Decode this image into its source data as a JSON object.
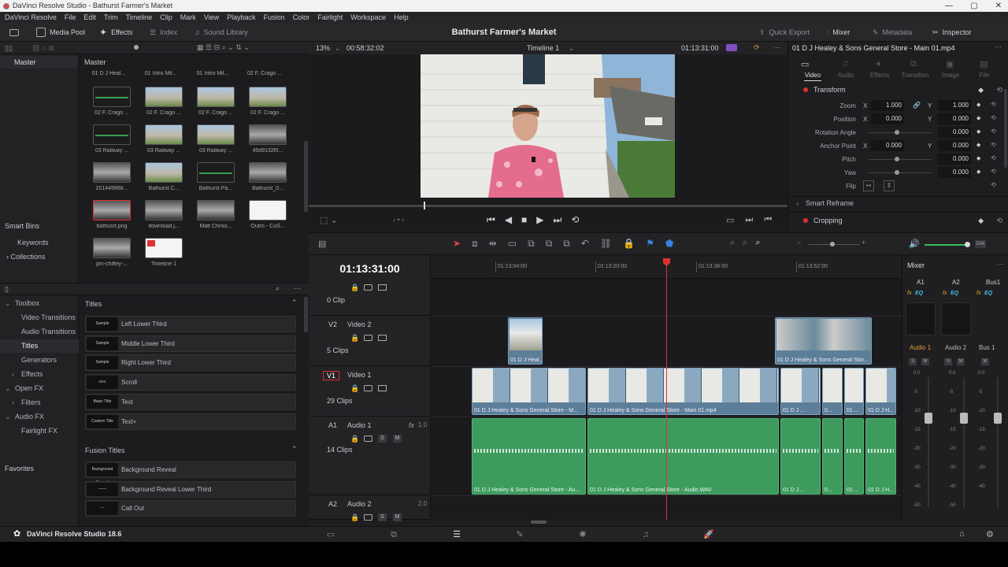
{
  "window": {
    "title": "DaVinci Resolve Studio - Bathurst Farmer's Market",
    "controls": [
      "—",
      "▢",
      "✕"
    ]
  },
  "menu": [
    "DaVinci Resolve",
    "File",
    "Edit",
    "Trim",
    "Timeline",
    "Clip",
    "Mark",
    "View",
    "Playback",
    "Fusion",
    "Color",
    "Fairlight",
    "Workspace",
    "Help"
  ],
  "toolbar": {
    "media_pool": "Media Pool",
    "effects": "Effects",
    "index": "Index",
    "sound_library": "Sound Library",
    "project_title": "Bathurst Farmer's Market",
    "quick_export": "Quick Export",
    "mixer": "Mixer",
    "metadata": "Metadata",
    "inspector": "Inspector"
  },
  "viewer": {
    "zoom": "13%",
    "duration": "00:58:32:02",
    "timeline_name": "Timeline 1",
    "timecode": "01:13:31:00",
    "clip_name": "01 D J Healey & Sons General Store - Main 01.mp4"
  },
  "bins": {
    "master_left": "Master",
    "master_right": "Master",
    "smart_bins": "Smart Bins",
    "keywords": "Keywords",
    "collections": "Collections",
    "favorites": "Favorites"
  },
  "media": {
    "top_labels": [
      "01 D J Heal...",
      "01 Intro Mil...",
      "01 Intro Mil...",
      "02 F. Crago ..."
    ],
    "items": [
      {
        "label": "02 F. Crago ...",
        "kind": "audio"
      },
      {
        "label": "02 F. Crago ...",
        "kind": "video"
      },
      {
        "label": "02 F. Crago ...",
        "kind": "video"
      },
      {
        "label": "02 F. Crago ...",
        "kind": "video"
      },
      {
        "label": "03 Railway ...",
        "kind": "audio"
      },
      {
        "label": "03 Railway ...",
        "kind": "video"
      },
      {
        "label": "03 Railway ...",
        "kind": "video"
      },
      {
        "label": "49d9132f0...",
        "kind": "photo"
      },
      {
        "label": "201449968...",
        "kind": "photo"
      },
      {
        "label": "Bathurst C...",
        "kind": "video"
      },
      {
        "label": "Bathurst Pa...",
        "kind": "audio"
      },
      {
        "label": "Bathurst_0...",
        "kind": "photo"
      },
      {
        "label": "bathusrt.png",
        "kind": "photo"
      },
      {
        "label": "download.j...",
        "kind": "photo"
      },
      {
        "label": "Matt Chriss...",
        "kind": "photo"
      },
      {
        "label": "Outro - CoS...",
        "kind": "white"
      },
      {
        "label": "pm-chifley-...",
        "kind": "photo"
      },
      {
        "label": "Timeline 1",
        "kind": "timeline"
      }
    ]
  },
  "fx_tree": [
    {
      "label": "Toolbox",
      "indent": 0,
      "arrow": "⌄"
    },
    {
      "label": "Video Transitions",
      "indent": 1
    },
    {
      "label": "Audio Transitions",
      "indent": 1
    },
    {
      "label": "Titles",
      "indent": 1,
      "selected": true
    },
    {
      "label": "Generators",
      "indent": 1
    },
    {
      "label": "Effects",
      "indent": 1,
      "arrow": "›"
    },
    {
      "label": "Open FX",
      "indent": 0,
      "arrow": "⌄"
    },
    {
      "label": "Filters",
      "indent": 1,
      "arrow": "›"
    },
    {
      "label": "Audio FX",
      "indent": 0,
      "arrow": "⌄"
    },
    {
      "label": "Fairlight FX",
      "indent": 1
    }
  ],
  "fx_titles": {
    "header": "Titles",
    "items": [
      {
        "label": "Left Lower Third",
        "mini": "Sample"
      },
      {
        "label": "Middle Lower Third",
        "mini": "Sample"
      },
      {
        "label": "Right Lower Third",
        "mini": "Sample"
      },
      {
        "label": "Scroll",
        "mini": "≡≡≡"
      },
      {
        "label": "Text",
        "mini": "Basic Title"
      },
      {
        "label": "Text+",
        "mini": "Custom Title"
      }
    ]
  },
  "fx_fusion": {
    "header": "Fusion Titles",
    "items": [
      {
        "label": "Background Reveal",
        "mini": "Background Reveal"
      },
      {
        "label": "Background Reveal Lower Third",
        "mini": "───"
      },
      {
        "label": "Call Out",
        "mini": "—"
      }
    ]
  },
  "inspector": {
    "tabs": [
      "Video",
      "Audio",
      "Effects",
      "Transition",
      "Image",
      "File"
    ],
    "transform": "Transform",
    "zoom_label": "Zoom",
    "zoom_x": "1.000",
    "zoom_y": "1.000",
    "position_label": "Position",
    "pos_x": "0.000",
    "pos_y": "0.000",
    "rotation_label": "Rotation Angle",
    "rotation": "0.000",
    "anchor_label": "Anchor Point",
    "anchor_x": "0.000",
    "anchor_y": "0.000",
    "pitch_label": "Pitch",
    "pitch": "0.000",
    "yaw_label": "Yaw",
    "yaw": "0.000",
    "flip_label": "Flip",
    "axis_x": "X",
    "axis_y": "Y",
    "smart_reframe": "Smart Reframe",
    "cropping": "Cropping"
  },
  "timeline": {
    "timecode": "01:13:31:00",
    "ruler": [
      "01:13:04:00",
      "01:13:20:00",
      "01:13:36:00",
      "01:13:52:00"
    ],
    "tracks": [
      {
        "id": "",
        "name": "",
        "clips": "0 Clip"
      },
      {
        "id": "V2",
        "name": "Video 2",
        "clips": "5 Clips"
      },
      {
        "id": "V1",
        "name": "Video 1",
        "clips": "29 Clips"
      },
      {
        "id": "A1",
        "name": "Audio 1",
        "clips": "14 Clips",
        "fx": "fx",
        "level": "1.0"
      },
      {
        "id": "A2",
        "name": "Audio 2",
        "level": "2.0"
      }
    ],
    "v2_clips": [
      "01 D J Heal...",
      "01 D J Healey & Sons General Stor..."
    ],
    "v1_clips": [
      "01 D J Healey & Sons General Store - M...",
      "01 D J Healey & Sons General Store - Main 01.mp4",
      "01 D J ...",
      "0...",
      "01 ...",
      "01 D J H..."
    ],
    "a1_clips": [
      "01 D J Healey & Sons General Store - Au...",
      "01 D J Healey & Sons General Store - Audio.WAV",
      "01 D J ...",
      "0...",
      "01 ...",
      "01 D J H..."
    ],
    "solo": "S",
    "mute": "M"
  },
  "mixer": {
    "title": "Mixer",
    "channels": [
      "A1",
      "A2",
      "Bus1"
    ],
    "strips": [
      "Audio 1",
      "Audio 2",
      "Bus 1"
    ],
    "eq": "EQ",
    "fx": "fx",
    "scale": [
      "0.0",
      "-5",
      "-10",
      "-15",
      "-20",
      "-30",
      "-40",
      "-50"
    ]
  },
  "footer": {
    "app": "DaVinci Resolve Studio 18.6"
  }
}
